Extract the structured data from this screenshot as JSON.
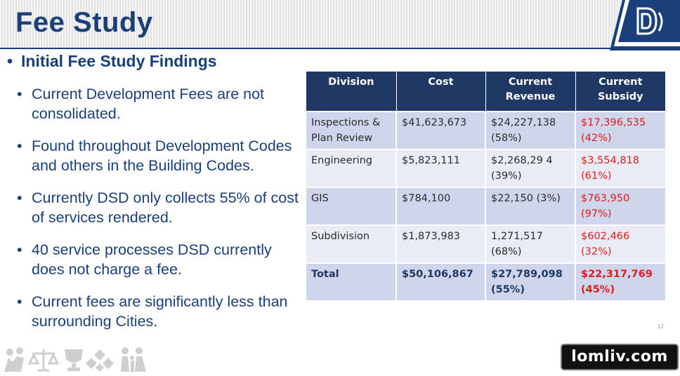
{
  "slide": {
    "title": "Fee Study",
    "page_number": "12"
  },
  "findings": {
    "heading_bullet": "•",
    "heading": "Initial Fee Study Findings",
    "sub_bullet": "•",
    "items": [
      "Current Development Fees are not consolidated.",
      "Found throughout Development Codes and others in the Building Codes.",
      "Currently DSD only collects 55% of cost of services rendered.",
      "40 service processes DSD currently does not charge a fee.",
      "Current fees are significantly less than surrounding Cities."
    ]
  },
  "fee_table": {
    "headers": [
      "Division",
      "Cost",
      "Current Revenue",
      "Current Subsidy"
    ],
    "rows": [
      {
        "division": "Inspections & Plan Review",
        "cost": "$41,623,673",
        "revenue": "$24,227,138 (58%)",
        "subsidy": "$17,396,535 (42%)"
      },
      {
        "division": "Engineering",
        "cost": "$5,823,111",
        "revenue": "$2,268,29 4 (39%)",
        "subsidy": "$3,554,818 (61%)"
      },
      {
        "division": "GIS",
        "cost": "$784,100",
        "revenue": "$22,150 (3%)",
        "subsidy": "$763,950 (97%)"
      },
      {
        "division": "Subdivision",
        "cost": "$1,873,983",
        "revenue": "1,271,517 (68%)",
        "subsidy": "$602,466 (32%)"
      }
    ],
    "total": {
      "division": "Total",
      "cost": "$50,106,867",
      "revenue": "$27,789,098 (55%)",
      "subsidy": "$22,317,769 (45%)"
    }
  },
  "watermark": {
    "text": "lomliv.com"
  },
  "icons": {
    "logo": "dsd-logo-icon",
    "footer": [
      "people-icon",
      "scales-icon",
      "trophy-icon",
      "diamond-pattern-icon",
      "family-icon"
    ]
  },
  "colors": {
    "title_blue": "#1a3f7a",
    "table_header": "#1f3864",
    "row_dark": "#cfd5ea",
    "row_light": "#e9ebf5",
    "subsidy_red": "#e21b1b"
  }
}
